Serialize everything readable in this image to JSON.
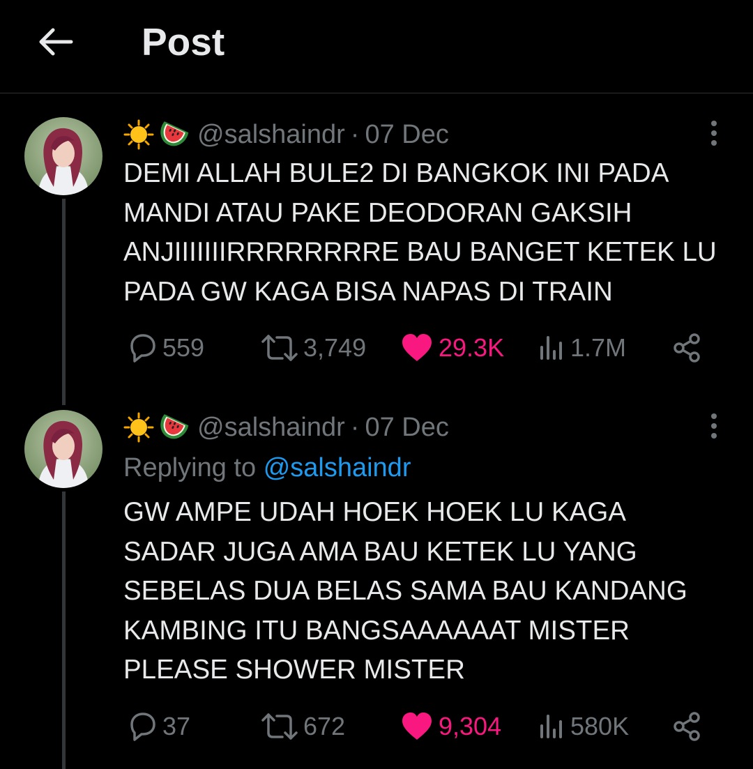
{
  "header": {
    "title": "Post",
    "back_icon": "arrow-left-icon"
  },
  "colors": {
    "background": "#000000",
    "text": "#e7e9ea",
    "muted": "#71767b",
    "link": "#1d9bf0",
    "like": "#f91880",
    "divider": "#2f3336"
  },
  "tweets": [
    {
      "display_name_emojis": [
        "sun-emoji",
        "watermelon-emoji"
      ],
      "handle": "@salshaindr",
      "separator": "·",
      "date": "07 Dec",
      "replying_label": "",
      "replying_to": "",
      "text": "DEMI ALLAH BULE2 DI BANGKOK INI PADA\nMANDI ATAU PAKE DEODORAN GAKSIH\nANJIIIIIIIRRRRRRRRE BAU BANGET KETEK LU\nPADA GW KAGA BISA NAPAS DI TRAIN",
      "replies": "559",
      "reposts": "3,749",
      "likes": "29.3K",
      "views": "1.7M",
      "liked": true
    },
    {
      "display_name_emojis": [
        "sun-emoji",
        "watermelon-emoji"
      ],
      "handle": "@salshaindr",
      "separator": "·",
      "date": "07 Dec",
      "replying_label": "Replying to",
      "replying_to": "@salshaindr",
      "text": "GW AMPE UDAH HOEK HOEK LU KAGA\nSADAR JUGA AMA BAU KETEK LU YANG\nSEBELAS DUA BELAS SAMA BAU KANDANG\nKAMBING ITU BANGSAAAAAAT MISTER\nPLEASE SHOWER MISTER",
      "replies": "37",
      "reposts": "672",
      "likes": "9,304",
      "views": "580K",
      "liked": true
    }
  ]
}
